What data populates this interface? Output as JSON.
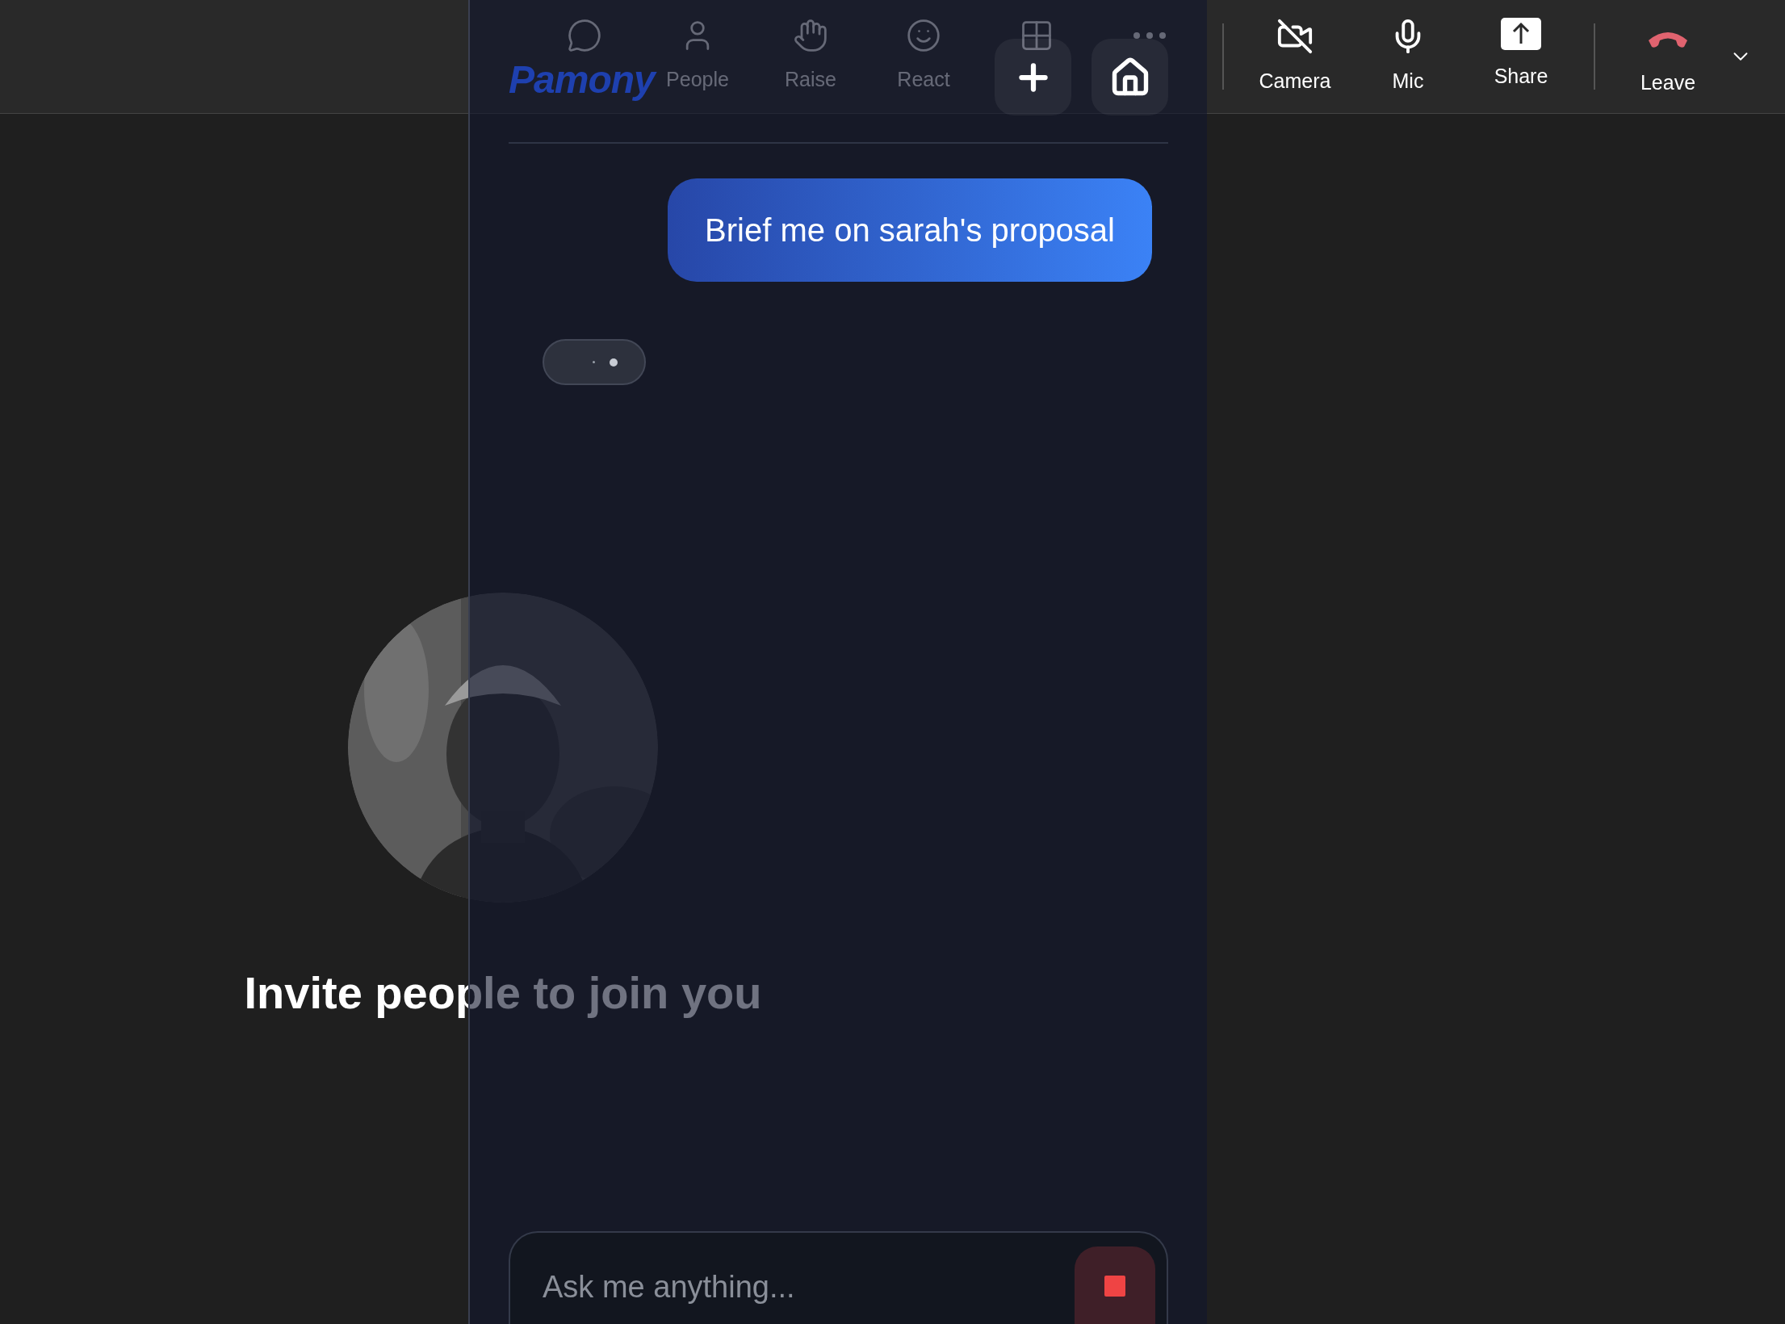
{
  "toolbar": {
    "items": [
      {
        "kind": "chat"
      },
      {
        "label": "People",
        "kind": "people"
      },
      {
        "label": "Raise",
        "kind": "raise"
      },
      {
        "label": "React",
        "kind": "react"
      },
      {
        "kind": "view"
      },
      {
        "kind": "more"
      }
    ],
    "controls": [
      {
        "label": "Camera",
        "kind": "camera",
        "on": false
      },
      {
        "label": "Mic",
        "kind": "mic",
        "on": true
      },
      {
        "label": "Share",
        "kind": "share"
      }
    ],
    "leave": {
      "label": "Leave"
    }
  },
  "stage": {
    "invite_text": "Invite people to join you"
  },
  "assistant_panel": {
    "logo": "Pamony",
    "header_buttons": [
      {
        "kind": "add"
      },
      {
        "kind": "home"
      }
    ],
    "messages": [
      {
        "kind": "user",
        "text": "Brief me on sarah's proposal"
      }
    ],
    "typing": true,
    "input": {
      "placeholder": "Ask me anything..."
    }
  }
}
